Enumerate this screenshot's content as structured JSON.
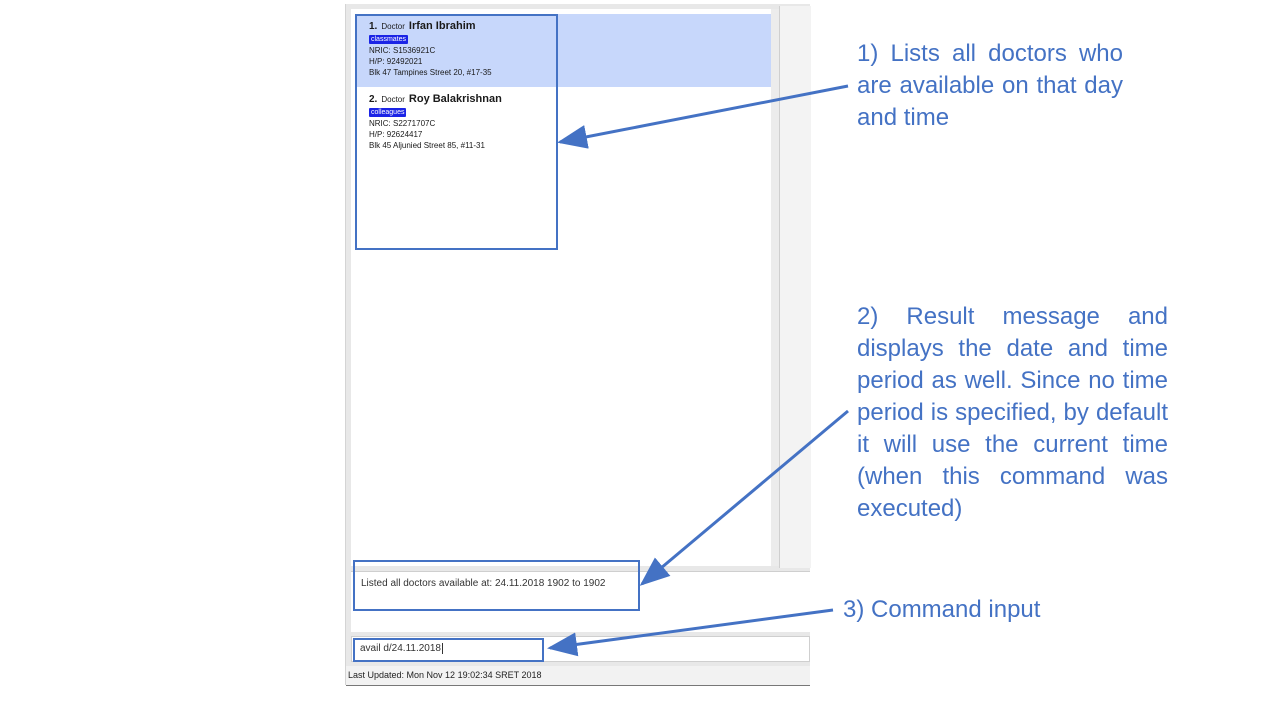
{
  "doctor_list": [
    {
      "index": "1.",
      "role": "Doctor",
      "name": "Irfan Ibrahim",
      "tag": "classmates",
      "nric": "NRIC: S1536921C",
      "phone": "H/P: 92492021",
      "address": "Blk 47 Tampines Street 20, #17-35",
      "selected": true
    },
    {
      "index": "2.",
      "role": "Doctor",
      "name": "Roy Balakrishnan",
      "tag": "colleagues",
      "nric": "NRIC: S2271707C",
      "phone": "H/P: 92624417",
      "address": "Blk 45 Aljunied Street 85, #11-31",
      "selected": false
    }
  ],
  "result": {
    "message": "Listed all doctors available at: 24.11.2018 1902 to 1902"
  },
  "command": {
    "value": "avail d/24.11.2018"
  },
  "status_bar": {
    "text": "Last Updated: Mon Nov 12 19:02:34 SRET 2018"
  },
  "annotations": {
    "doctors_list": "1) Lists all doctors who are available on that day and time",
    "result_message": "2) Result message and displays the date and time period as well. Since no time period is specified, by default it will use the current time (when this command was executed)",
    "command_input": "3) Command input"
  },
  "colors": {
    "annotation_blue": "#4472c4",
    "selected_card": "#c7d7fb",
    "tag_blue": "#1b24e6"
  }
}
